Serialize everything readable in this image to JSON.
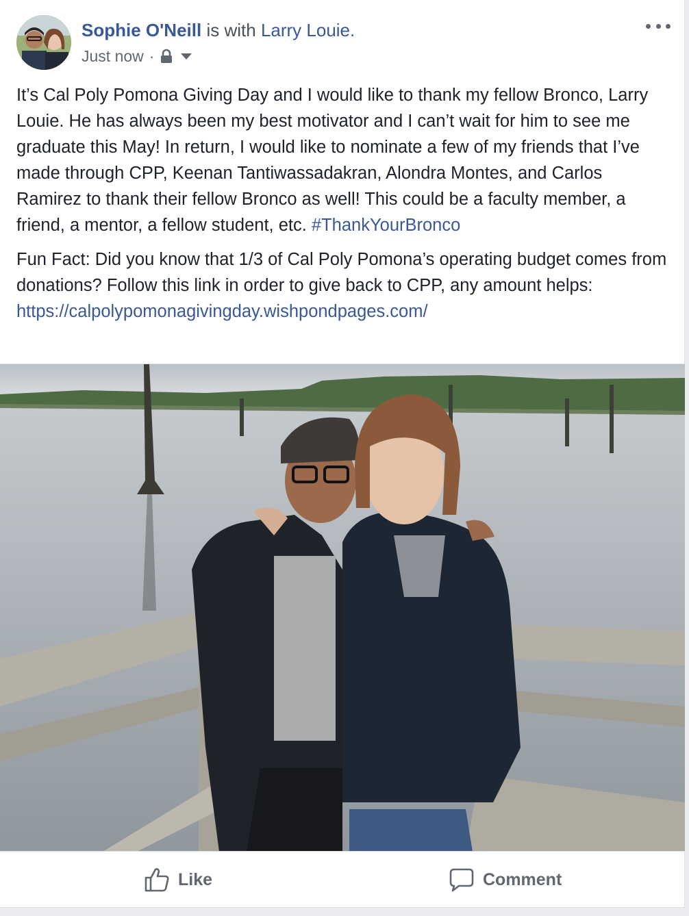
{
  "post": {
    "author": "Sophie O'Neill",
    "with_text": "is with",
    "tagged": "Larry Louie.",
    "timestamp": "Just now",
    "separator": "·",
    "privacy_icon": "lock-icon",
    "audience_menu_icon": "caret-down-icon",
    "more_icon": "ellipsis-icon",
    "paragraph1": "It’s Cal Poly Pomona Giving Day and I would like to thank my fellow Bronco, Larry Louie. He has always been my best motivator and I can’t wait for him to see me graduate this May! In return, I would like to nominate a few of my friends that I’ve made through CPP, Keenan Tantiwassadakran, Alondra Montes, and Carlos Ramirez to thank their fellow Bronco as well! This could be a faculty member, a friend, a mentor, a fellow student, etc.",
    "hashtag": "#ThankYourBronco",
    "paragraph2": "Fun Fact: Did you know that 1/3 of Cal Poly Pomona’s operating budget comes from donations? Follow this link in order to give back to CPP, any amount helps:",
    "link": "https://calpolypomonagivingday.wishpondpages.com/"
  },
  "actions": {
    "like_label": "Like",
    "like_icon": "thumbs-up-icon",
    "comment_label": "Comment",
    "comment_icon": "speech-bubble-icon"
  },
  "colors": {
    "link": "#385898",
    "muted": "#616770",
    "text": "#1d2129"
  }
}
